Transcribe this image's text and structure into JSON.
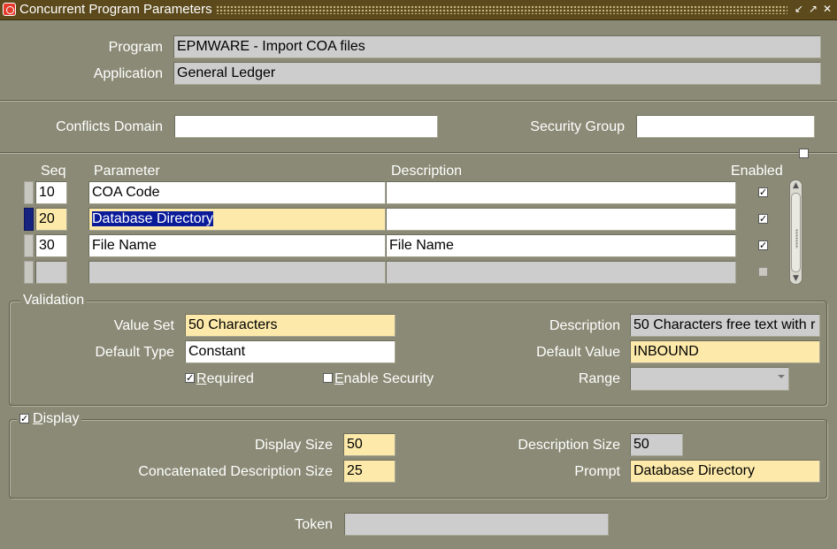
{
  "window": {
    "title": "Concurrent Program Parameters"
  },
  "header": {
    "program_label": "Program",
    "program_value": "EPMWARE - Import COA files",
    "application_label": "Application",
    "application_value": "General Ledger",
    "conflicts_domain_label": "Conflicts Domain",
    "conflicts_domain_value": "",
    "security_group_label": "Security Group",
    "security_group_value": ""
  },
  "table": {
    "columns": {
      "seq": "Seq",
      "parameter": "Parameter",
      "description": "Description",
      "enabled": "Enabled"
    },
    "rows": [
      {
        "seq": "10",
        "parameter": "COA Code",
        "description": "",
        "enabled": true
      },
      {
        "seq": "20",
        "parameter": "Database Directory",
        "description": "",
        "enabled": true
      },
      {
        "seq": "30",
        "parameter": "File Name",
        "description": "File Name",
        "enabled": true
      },
      {
        "seq": "",
        "parameter": "",
        "description": "",
        "enabled": false
      }
    ]
  },
  "validation": {
    "legend": "Validation",
    "value_set_label": "Value Set",
    "value_set_value": "50 Characters",
    "description_label": "Description",
    "description_value": "50 Characters free text with r",
    "default_type_label": "Default Type",
    "default_type_value": "Constant",
    "default_value_label": "Default Value",
    "default_value_value": "INBOUND",
    "required_first": "R",
    "required_rest": "equired",
    "required_checked": true,
    "enable_security_first": "E",
    "enable_security_rest": "nable Security",
    "enable_security_checked": false,
    "range_label": "Range",
    "range_value": ""
  },
  "display": {
    "legend_first": "D",
    "legend_rest": "isplay",
    "checked": true,
    "display_size_label": "Display Size",
    "display_size_value": "50",
    "description_size_label": "Description Size",
    "description_size_value": "50",
    "concat_size_label": "Concatenated Description Size",
    "concat_size_value": "25",
    "prompt_label": "Prompt",
    "prompt_value": "Database Directory"
  },
  "token": {
    "label": "Token",
    "value": ""
  },
  "icons": {
    "window_controls": [
      "minimize-icon",
      "maximize-icon",
      "close-icon"
    ],
    "checkmark": "✓"
  },
  "colors": {
    "background": "#8a8a76",
    "titlebar": "#5c4a1c",
    "required_field": "#fdeaaa",
    "readonly_field": "#cdcdcd",
    "selection": "#0a1b9a"
  }
}
